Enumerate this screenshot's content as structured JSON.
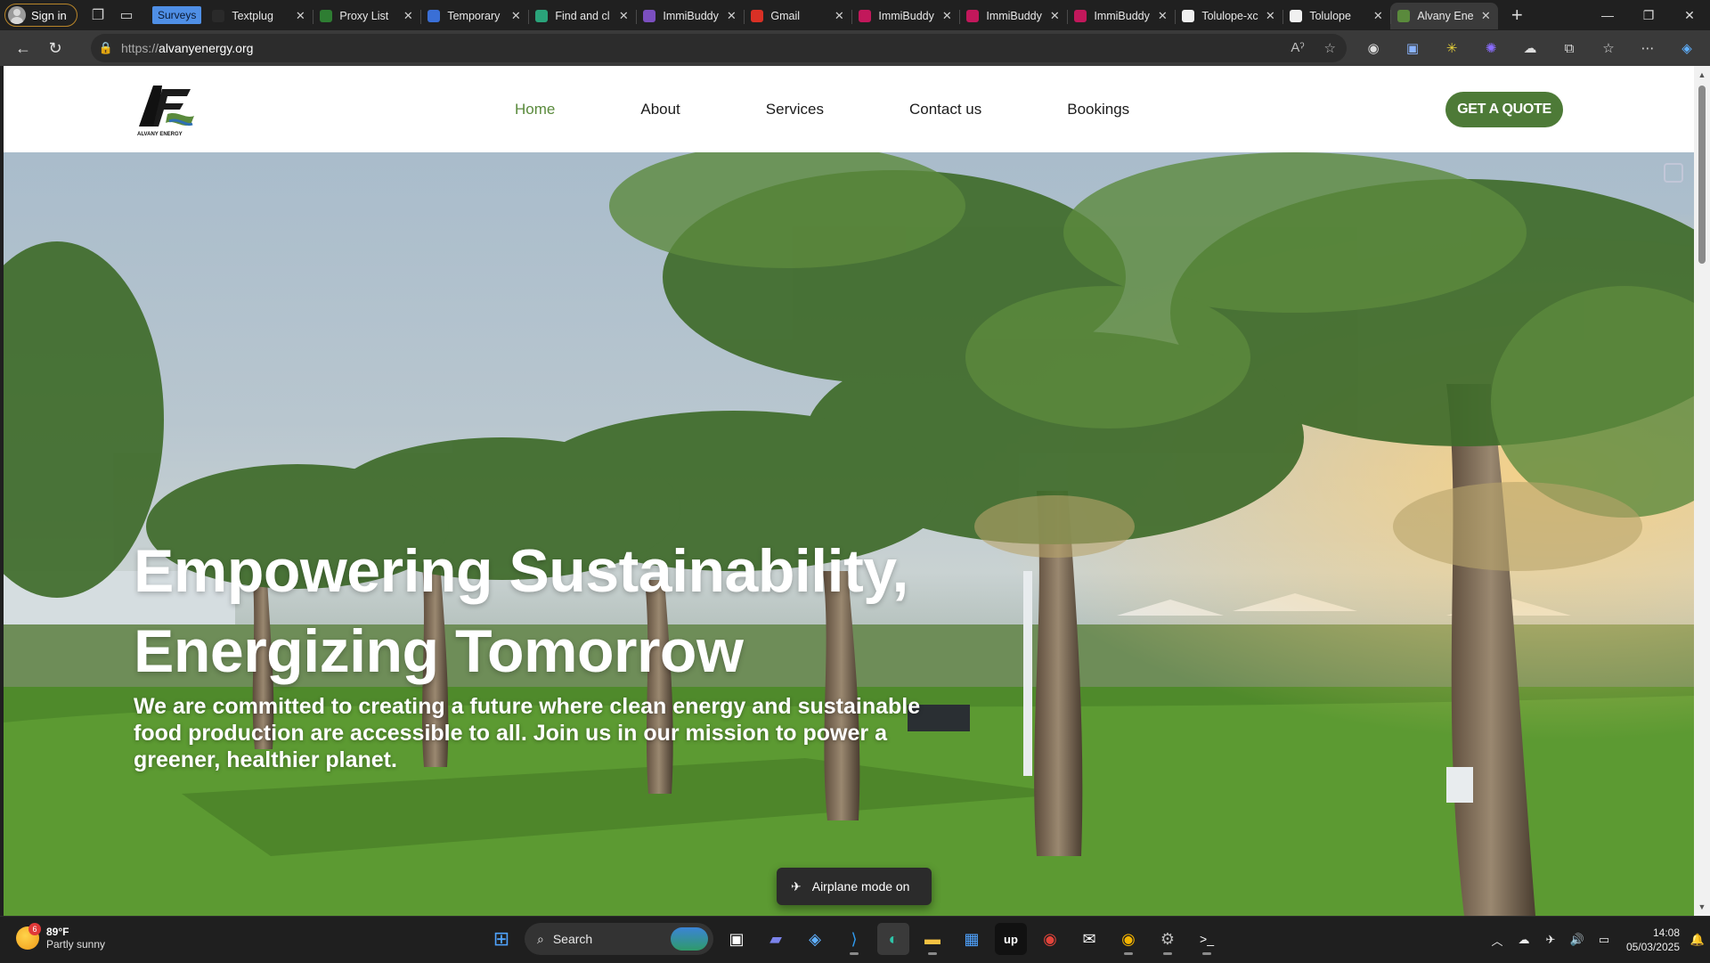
{
  "browser": {
    "signin_label": "Sign in",
    "surveys_label": "Surveys",
    "tabs": [
      {
        "title": "Textplug",
        "favicon_color": "#2a2a2a"
      },
      {
        "title": "Proxy List",
        "favicon_color": "#2e7d32"
      },
      {
        "title": "Temporary",
        "favicon_color": "#3a6fd6"
      },
      {
        "title": "Find and cl",
        "favicon_color": "#2aa37a"
      },
      {
        "title": "ImmiBuddy",
        "favicon_color": "#7b4fbf"
      },
      {
        "title": "Gmail",
        "favicon_color": "#d93025"
      },
      {
        "title": "ImmiBuddy",
        "favicon_color": "#c2185b"
      },
      {
        "title": "ImmiBuddy",
        "favicon_color": "#c2185b"
      },
      {
        "title": "ImmiBuddy",
        "favicon_color": "#c2185b"
      },
      {
        "title": "Tolulope-xc",
        "favicon_color": "#f0f0f0"
      },
      {
        "title": "Tolulope",
        "favicon_color": "#f0f0f0"
      },
      {
        "title": "Alvany Ene",
        "favicon_color": "#5a8a3c",
        "active": true
      }
    ],
    "address": {
      "prefix": "https://",
      "host": "alvanyenergy.org"
    }
  },
  "site": {
    "nav": {
      "home": "Home",
      "about": "About",
      "services": "Services",
      "contact": "Contact us",
      "bookings": "Bookings"
    },
    "cta_label": "GET A QUOTE",
    "hero": {
      "title_line1": "Empowering Sustainability,",
      "title_line2": "Energizing Tomorrow",
      "subtitle": "We are committed to creating a future where clean energy and sustainable food production are accessible to all. Join us in our mission to power a greener, healthier planet."
    },
    "logo_text": "ALVANY ENERGY",
    "colors": {
      "brand_green": "#4d7a37",
      "nav_active": "#5a8a3c"
    }
  },
  "toast": {
    "text": "Airplane mode on"
  },
  "taskbar": {
    "weather": {
      "temp": "89°F",
      "condition": "Partly sunny",
      "badge": "6"
    },
    "search_label": "Search",
    "time": "14:08",
    "date": "05/03/2025"
  }
}
